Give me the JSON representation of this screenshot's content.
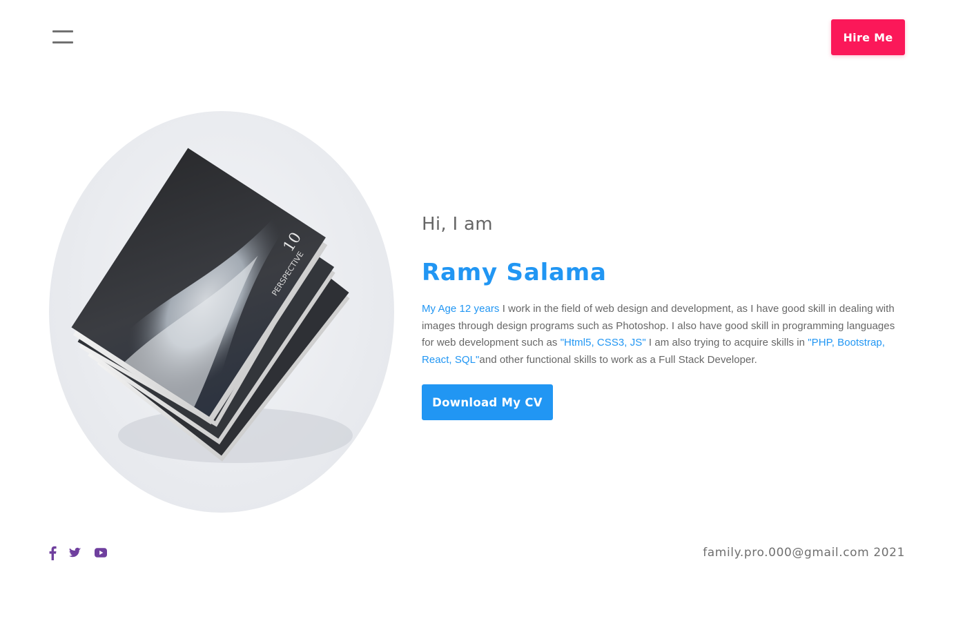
{
  "header": {
    "menu_icon": "hamburger-menu-icon",
    "hire_label": "Hire Me",
    "hire_color": "#fb1859"
  },
  "hero": {
    "image_alt": "stack of books",
    "greeting": "Hi, I am",
    "name": "Ramy Salama",
    "accent_color": "#2196f3",
    "bio": {
      "part1_highlight": "My Age 12 years",
      "part2": " I work in the field of web design and development, as I have good skill in dealing with images through design programs such as Photoshop. I also have good skill in programming languages for web development such as ",
      "part3_highlight": "\"Html5, CSS3, JS\"",
      "part4": " I am also trying to acquire skills in ",
      "part5_highlight": "\"PHP, Bootstrap, React, SQL\"",
      "part6": "and other functional skills to work as a Full Stack Developer."
    },
    "cv_label": "Download My CV"
  },
  "footer": {
    "social": [
      {
        "icon": "facebook-icon"
      },
      {
        "icon": "twitter-icon"
      },
      {
        "icon": "youtube-icon"
      }
    ],
    "social_color": "#6f3f9e",
    "contact": "family.pro.000@gmail.com 2021"
  }
}
